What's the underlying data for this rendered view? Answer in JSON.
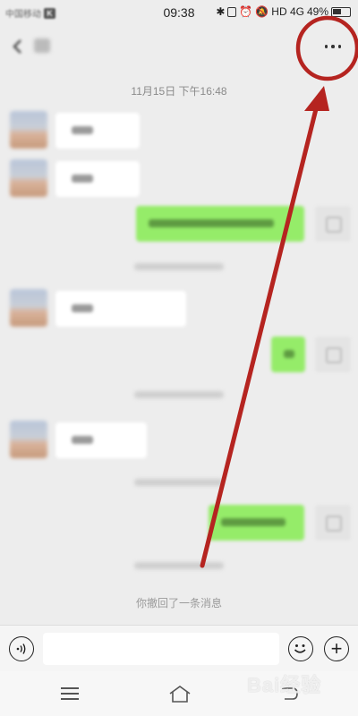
{
  "status_bar": {
    "carrier": "中国移动",
    "carrier_badge": "K",
    "time": "09:38",
    "network": "HD 4G",
    "battery": "49%"
  },
  "header": {
    "more_icon": "more-horizontal-icon"
  },
  "chat": {
    "timestamp": "11月15日 下午16:48",
    "recall_notice": "你撤回了一条消息",
    "colors": {
      "background": "#ededed",
      "incoming_bubble": "#ffffff",
      "outgoing_bubble": "#95ec69"
    }
  },
  "input_bar": {
    "placeholder": "",
    "voice_icon": "voice-icon",
    "emoji_icon": "emoji-icon",
    "plus_icon": "plus-icon"
  },
  "nav_bar": {
    "items": [
      "menu-icon",
      "home-icon",
      "back-icon"
    ]
  },
  "watermark": {
    "text": "Bai经验"
  },
  "annotation": {
    "color": "#b52420"
  }
}
